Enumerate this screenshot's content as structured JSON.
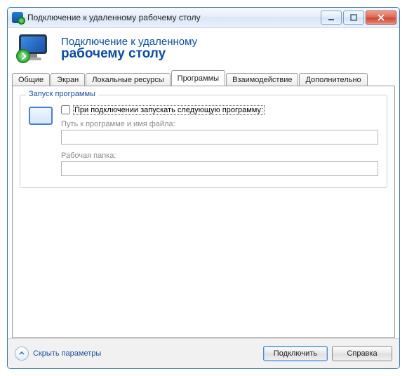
{
  "window": {
    "title": "Подключение к удаленному рабочему столу"
  },
  "header": {
    "line1": "Подключение к удаленному",
    "line2": "рабочему столу"
  },
  "tabs": {
    "general": "Общие",
    "display": "Экран",
    "local_resources": "Локальные ресурсы",
    "programs": "Программы",
    "experience": "Взаимодействие",
    "advanced": "Дополнительно"
  },
  "programs_tab": {
    "group_title": "Запуск программы",
    "checkbox_label": "При подключении запускать следующую программу:",
    "checkbox_checked": false,
    "path_label": "Путь к программе и имя файла:",
    "path_value": "",
    "folder_label": "Рабочая папка:",
    "folder_value": ""
  },
  "footer": {
    "hide_options": "Скрыть параметры",
    "connect": "Подключить",
    "help": "Справка"
  }
}
